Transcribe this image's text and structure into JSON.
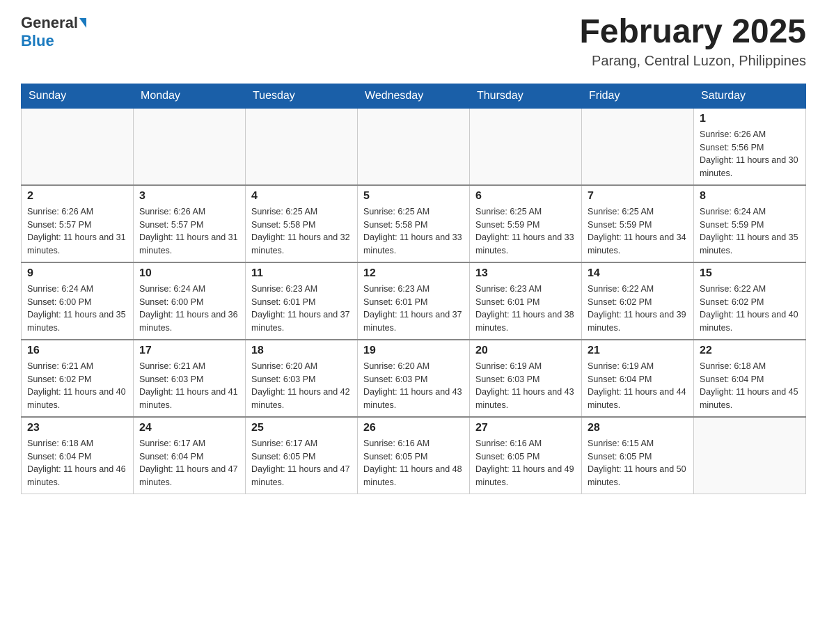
{
  "header": {
    "logo_general": "General",
    "logo_blue": "Blue",
    "month_title": "February 2025",
    "location": "Parang, Central Luzon, Philippines"
  },
  "weekdays": [
    "Sunday",
    "Monday",
    "Tuesday",
    "Wednesday",
    "Thursday",
    "Friday",
    "Saturday"
  ],
  "weeks": [
    [
      {
        "day": "",
        "info": ""
      },
      {
        "day": "",
        "info": ""
      },
      {
        "day": "",
        "info": ""
      },
      {
        "day": "",
        "info": ""
      },
      {
        "day": "",
        "info": ""
      },
      {
        "day": "",
        "info": ""
      },
      {
        "day": "1",
        "info": "Sunrise: 6:26 AM\nSunset: 5:56 PM\nDaylight: 11 hours and 30 minutes."
      }
    ],
    [
      {
        "day": "2",
        "info": "Sunrise: 6:26 AM\nSunset: 5:57 PM\nDaylight: 11 hours and 31 minutes."
      },
      {
        "day": "3",
        "info": "Sunrise: 6:26 AM\nSunset: 5:57 PM\nDaylight: 11 hours and 31 minutes."
      },
      {
        "day": "4",
        "info": "Sunrise: 6:25 AM\nSunset: 5:58 PM\nDaylight: 11 hours and 32 minutes."
      },
      {
        "day": "5",
        "info": "Sunrise: 6:25 AM\nSunset: 5:58 PM\nDaylight: 11 hours and 33 minutes."
      },
      {
        "day": "6",
        "info": "Sunrise: 6:25 AM\nSunset: 5:59 PM\nDaylight: 11 hours and 33 minutes."
      },
      {
        "day": "7",
        "info": "Sunrise: 6:25 AM\nSunset: 5:59 PM\nDaylight: 11 hours and 34 minutes."
      },
      {
        "day": "8",
        "info": "Sunrise: 6:24 AM\nSunset: 5:59 PM\nDaylight: 11 hours and 35 minutes."
      }
    ],
    [
      {
        "day": "9",
        "info": "Sunrise: 6:24 AM\nSunset: 6:00 PM\nDaylight: 11 hours and 35 minutes."
      },
      {
        "day": "10",
        "info": "Sunrise: 6:24 AM\nSunset: 6:00 PM\nDaylight: 11 hours and 36 minutes."
      },
      {
        "day": "11",
        "info": "Sunrise: 6:23 AM\nSunset: 6:01 PM\nDaylight: 11 hours and 37 minutes."
      },
      {
        "day": "12",
        "info": "Sunrise: 6:23 AM\nSunset: 6:01 PM\nDaylight: 11 hours and 37 minutes."
      },
      {
        "day": "13",
        "info": "Sunrise: 6:23 AM\nSunset: 6:01 PM\nDaylight: 11 hours and 38 minutes."
      },
      {
        "day": "14",
        "info": "Sunrise: 6:22 AM\nSunset: 6:02 PM\nDaylight: 11 hours and 39 minutes."
      },
      {
        "day": "15",
        "info": "Sunrise: 6:22 AM\nSunset: 6:02 PM\nDaylight: 11 hours and 40 minutes."
      }
    ],
    [
      {
        "day": "16",
        "info": "Sunrise: 6:21 AM\nSunset: 6:02 PM\nDaylight: 11 hours and 40 minutes."
      },
      {
        "day": "17",
        "info": "Sunrise: 6:21 AM\nSunset: 6:03 PM\nDaylight: 11 hours and 41 minutes."
      },
      {
        "day": "18",
        "info": "Sunrise: 6:20 AM\nSunset: 6:03 PM\nDaylight: 11 hours and 42 minutes."
      },
      {
        "day": "19",
        "info": "Sunrise: 6:20 AM\nSunset: 6:03 PM\nDaylight: 11 hours and 43 minutes."
      },
      {
        "day": "20",
        "info": "Sunrise: 6:19 AM\nSunset: 6:03 PM\nDaylight: 11 hours and 43 minutes."
      },
      {
        "day": "21",
        "info": "Sunrise: 6:19 AM\nSunset: 6:04 PM\nDaylight: 11 hours and 44 minutes."
      },
      {
        "day": "22",
        "info": "Sunrise: 6:18 AM\nSunset: 6:04 PM\nDaylight: 11 hours and 45 minutes."
      }
    ],
    [
      {
        "day": "23",
        "info": "Sunrise: 6:18 AM\nSunset: 6:04 PM\nDaylight: 11 hours and 46 minutes."
      },
      {
        "day": "24",
        "info": "Sunrise: 6:17 AM\nSunset: 6:04 PM\nDaylight: 11 hours and 47 minutes."
      },
      {
        "day": "25",
        "info": "Sunrise: 6:17 AM\nSunset: 6:05 PM\nDaylight: 11 hours and 47 minutes."
      },
      {
        "day": "26",
        "info": "Sunrise: 6:16 AM\nSunset: 6:05 PM\nDaylight: 11 hours and 48 minutes."
      },
      {
        "day": "27",
        "info": "Sunrise: 6:16 AM\nSunset: 6:05 PM\nDaylight: 11 hours and 49 minutes."
      },
      {
        "day": "28",
        "info": "Sunrise: 6:15 AM\nSunset: 6:05 PM\nDaylight: 11 hours and 50 minutes."
      },
      {
        "day": "",
        "info": ""
      }
    ]
  ]
}
